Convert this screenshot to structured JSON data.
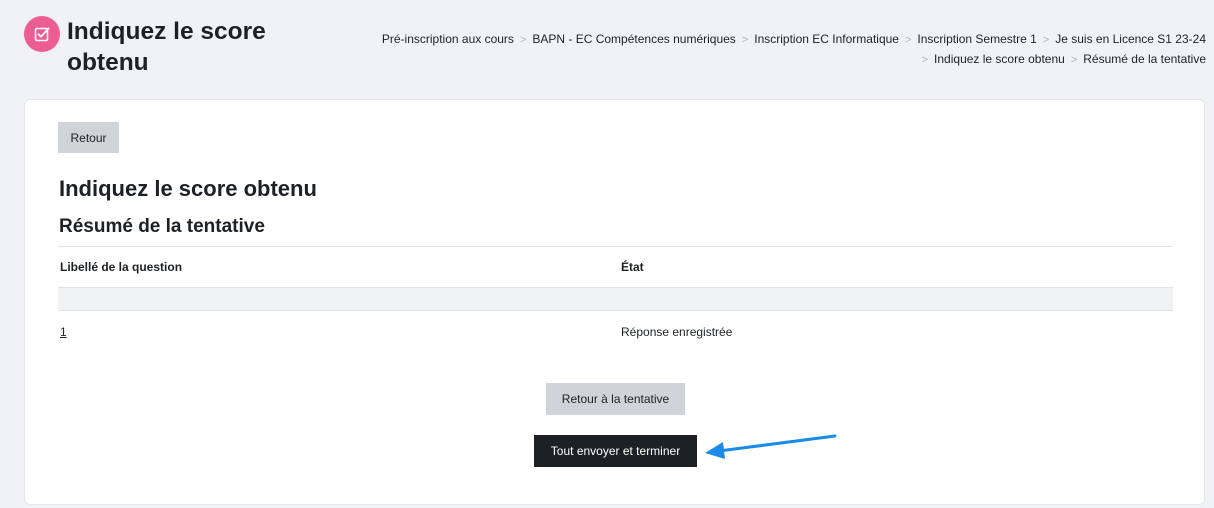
{
  "header": {
    "title": "Indiquez le score obtenu",
    "icon": "quiz-checkbox-icon",
    "icon_color": "#ec5d93"
  },
  "breadcrumb": [
    "Pré-inscription aux cours",
    "BAPN - EC Compétences numériques",
    "Inscription EC Informatique",
    "Inscription Semestre 1",
    "Je suis en Licence S1 23-24",
    "Indiquez le score obtenu",
    "Résumé de la tentative"
  ],
  "main": {
    "back_label": "Retour",
    "quiz_name": "Indiquez le score obtenu",
    "summary_title": "Résumé de la tentative",
    "table": {
      "headers": [
        "Libellé de la question",
        "État"
      ],
      "rows": [
        {
          "question": "1",
          "status": "Réponse enregistrée"
        }
      ]
    },
    "return_button_label": "Retour à la tentative",
    "submit_button_label": "Tout envoyer et terminer",
    "annotation_arrow_color": "#1a8be8"
  }
}
